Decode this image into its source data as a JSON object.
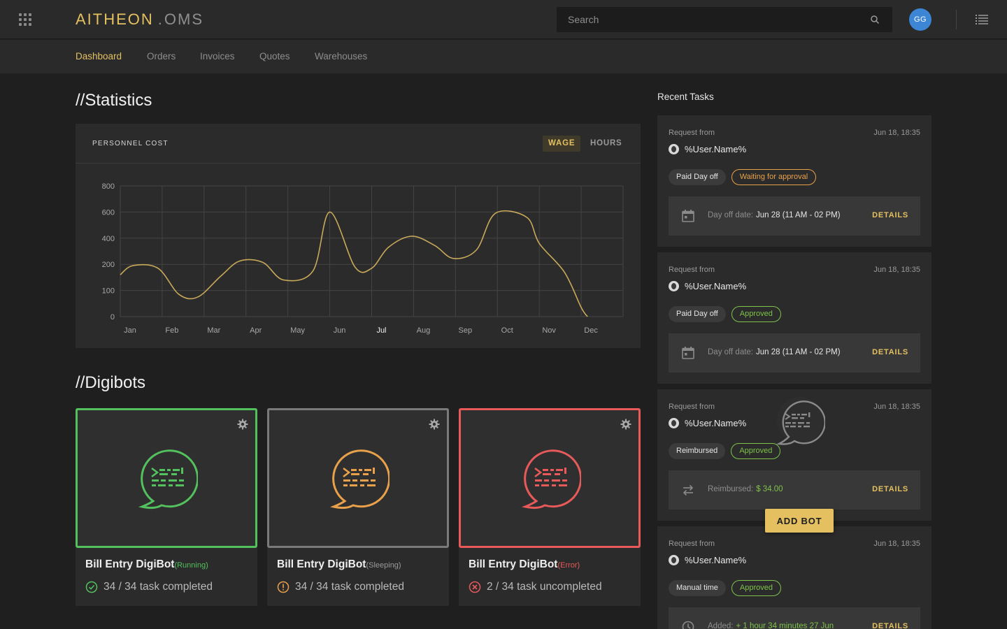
{
  "header": {
    "logo_brand": "AITHEON",
    "logo_dot": ".",
    "logo_suffix": "OMS",
    "search_placeholder": "Search",
    "avatar_initials": "GG",
    "avatar_color": "#3d86d6"
  },
  "nav": {
    "items": [
      {
        "label": "Dashboard",
        "active": true
      },
      {
        "label": "Orders",
        "active": false
      },
      {
        "label": "Invoices",
        "active": false
      },
      {
        "label": "Quotes",
        "active": false
      },
      {
        "label": "Warehouses",
        "active": false
      }
    ]
  },
  "statistics": {
    "section_title": "//Statistics",
    "card_title": "PERSONNEL COST",
    "toggle_wage": "WAGE",
    "toggle_hours": "HOURS",
    "selected_toggle": "WAGE"
  },
  "chart_data": {
    "type": "line",
    "title": "PERSONNEL COST",
    "categories": [
      "Jan",
      "Feb",
      "Mar",
      "Apr",
      "May",
      "Jun",
      "Jul",
      "Aug",
      "Sep",
      "Oct",
      "Nov",
      "Dec"
    ],
    "highlighted_category": "Jul",
    "y_ticks": [
      0,
      100,
      200,
      400,
      600,
      800
    ],
    "ylim": [
      0,
      800
    ],
    "grid": true,
    "line_color": "#e4c061",
    "series": [
      {
        "name": "",
        "x": [
          0,
          0.3,
          0.9,
          1.4,
          1.85,
          2.4,
          2.85,
          3.4,
          3.9,
          4.6,
          5.0,
          5.6,
          6.0,
          6.4,
          6.95,
          7.5,
          7.95,
          8.5,
          8.95,
          9.7,
          10.0,
          10.6,
          11.0,
          11.15
        ],
        "values": [
          160,
          195,
          185,
          85,
          75,
          155,
          225,
          215,
          140,
          175,
          600,
          190,
          185,
          330,
          415,
          345,
          245,
          310,
          590,
          560,
          360,
          170,
          35,
          0
        ]
      }
    ]
  },
  "digibots": {
    "section_title": "//Digibots",
    "bots": [
      {
        "name": "Bill Entry DigiBot",
        "state": "(Running)",
        "stat": "34 / 34 task completed",
        "color": "#52c15e",
        "frame_color": "#52c15e",
        "stat_icon": "check-circle-icon"
      },
      {
        "name": "Bill Entry DigiBot",
        "state": "(Sleeping)",
        "stat": "34 / 34 task completed",
        "color": "#e8a14a",
        "frame_color": "#7a7a7a",
        "stat_icon": "warning-circle-icon"
      },
      {
        "name": "Bill Entry DigiBot",
        "state": "(Error)",
        "stat": "2 / 34 task uncompleted",
        "color": "#e85a5a",
        "frame_color": "#e85a5a",
        "stat_icon": "error-circle-icon"
      }
    ]
  },
  "recent_tasks": {
    "title": "Recent Tasks",
    "tasks": [
      {
        "request_label": "Request from",
        "time": "Jun 18, 18:35",
        "user": "%User.Name%",
        "type": "Paid Day off",
        "status": "Waiting for approval",
        "status_kind": "waiting",
        "detail_icon": "calendar-icon",
        "detail_label": "Day off date:",
        "detail_value": "Jun 28 (11 AM - 02 PM)",
        "detail_value_green": false,
        "button": "DETAILS"
      },
      {
        "request_label": "Request from",
        "time": "Jun 18, 18:35",
        "user": "%User.Name%",
        "type": "Paid Day off",
        "status": "Approved",
        "status_kind": "approved",
        "detail_icon": "calendar-icon",
        "detail_label": "Day off date:",
        "detail_value": "Jun 28 (11 AM - 02 PM)",
        "detail_value_green": false,
        "button": "DETAILS"
      },
      {
        "request_label": "Request from",
        "time": "Jun 18, 18:35",
        "user": "%User.Name%",
        "type": "Reimbursed",
        "status": "Approved",
        "status_kind": "approved",
        "detail_icon": "transfer-icon",
        "detail_label": "Reimbursed:",
        "detail_value": "$ 34.00",
        "detail_value_green": true,
        "button": "DETAILS"
      },
      {
        "request_label": "Request from",
        "time": "Jun 18, 18:35",
        "user": "%User.Name%",
        "type": "Manual time",
        "status": "Approved",
        "status_kind": "approved",
        "detail_icon": "clock-icon",
        "detail_label": "Added:",
        "detail_value": "+ 1 hour 34 minutes 27 Jun",
        "detail_value_green": true,
        "button": "DETAILS"
      }
    ]
  },
  "add_bot_label": "ADD BOT"
}
